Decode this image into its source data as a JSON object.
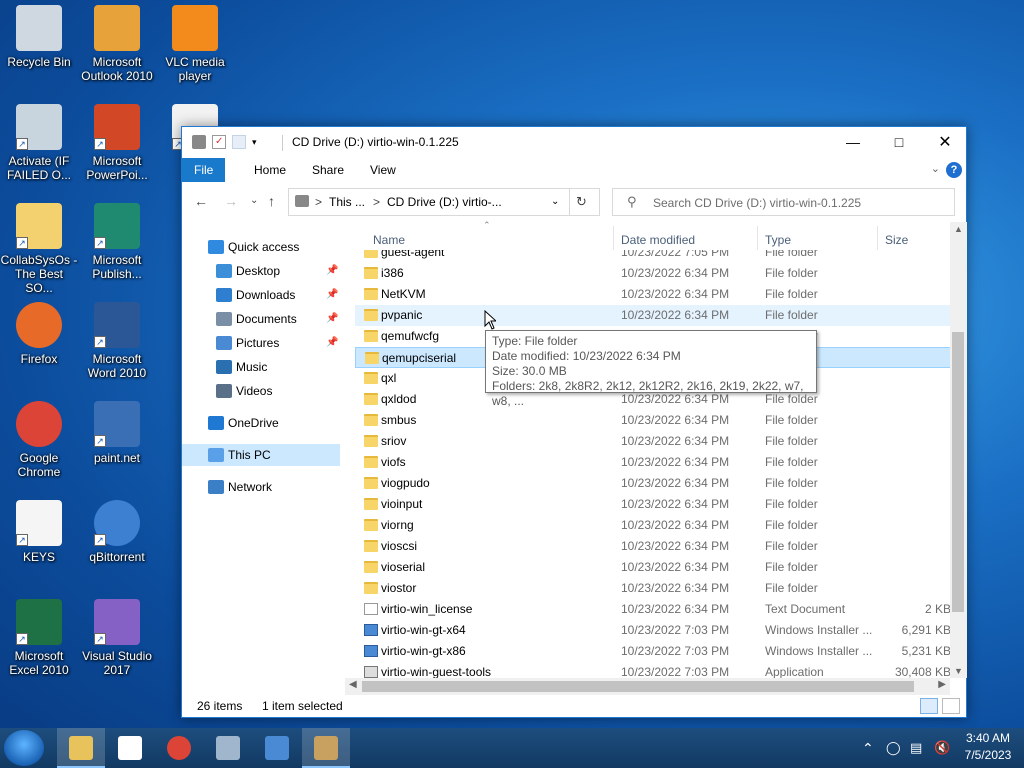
{
  "desktop": {
    "icons": [
      {
        "label": "Recycle Bin",
        "icon": "recycle-bin-icon"
      },
      {
        "label": "Microsoft Outlook 2010",
        "icon": "outlook-icon"
      },
      {
        "label": "VLC media player",
        "icon": "vlc-icon"
      },
      {
        "label": "Activate (IF FAILED O...",
        "icon": "activate-icon"
      },
      {
        "label": "Microsoft PowerPoi...",
        "icon": "powerpoint-icon"
      },
      {
        "label": "M",
        "icon": "document-icon"
      },
      {
        "label": "CollabSysOs - The Best SO...",
        "icon": "folder-icon"
      },
      {
        "label": "Microsoft Publish...",
        "icon": "publisher-icon"
      },
      {
        "label": "Firefox",
        "icon": "firefox-icon"
      },
      {
        "label": "Microsoft Word 2010",
        "icon": "word-icon"
      },
      {
        "label": "Google Chrome",
        "icon": "chrome-icon"
      },
      {
        "label": "paint.net",
        "icon": "paintnet-icon"
      },
      {
        "label": "KEYS",
        "icon": "text-file-icon"
      },
      {
        "label": "qBittorrent",
        "icon": "qbittorrent-icon"
      },
      {
        "label": "Microsoft Excel 2010",
        "icon": "excel-icon"
      },
      {
        "label": "Visual Studio 2017",
        "icon": "visual-studio-icon"
      }
    ]
  },
  "window": {
    "title": "CD Drive (D:) virtio-win-0.1.225",
    "ribbon_tabs": [
      "File",
      "Home",
      "Share",
      "View"
    ],
    "help": "?",
    "address": {
      "crumb1": "This ...",
      "crumb2": "CD Drive (D:) virtio-...",
      "sep": ">"
    },
    "search_placeholder": "Search CD Drive (D:) virtio-win-0.1.225",
    "nav": [
      {
        "label": "Quick access",
        "pinned": false
      },
      {
        "label": "Desktop",
        "pinned": true
      },
      {
        "label": "Downloads",
        "pinned": true
      },
      {
        "label": "Documents",
        "pinned": true
      },
      {
        "label": "Pictures",
        "pinned": true
      },
      {
        "label": "Music",
        "pinned": false
      },
      {
        "label": "Videos",
        "pinned": false
      },
      {
        "label": "OneDrive",
        "pinned": false
      },
      {
        "label": "This PC",
        "pinned": false
      },
      {
        "label": "Network",
        "pinned": false
      }
    ],
    "columns": {
      "name": "Name",
      "date": "Date modified",
      "type": "Type",
      "size": "Size"
    },
    "files": [
      {
        "name": "guest-agent",
        "date": "10/23/2022 7:05 PM",
        "type": "File folder",
        "size": "",
        "kind": "folder"
      },
      {
        "name": "i386",
        "date": "10/23/2022 6:34 PM",
        "type": "File folder",
        "size": "",
        "kind": "folder"
      },
      {
        "name": "NetKVM",
        "date": "10/23/2022 6:34 PM",
        "type": "File folder",
        "size": "",
        "kind": "folder"
      },
      {
        "name": "pvpanic",
        "date": "10/23/2022 6:34 PM",
        "type": "File folder",
        "size": "",
        "kind": "folder"
      },
      {
        "name": "qemufwcfg",
        "date": "10/23/2022 6:34 PM",
        "type": "File folder",
        "size": "",
        "kind": "folder"
      },
      {
        "name": "qemupciserial",
        "date": "",
        "type": "",
        "size": "",
        "kind": "folder"
      },
      {
        "name": "qxl",
        "date": "",
        "type": "",
        "size": "",
        "kind": "folder"
      },
      {
        "name": "qxldod",
        "date": "10/23/2022 6:34 PM",
        "type": "File folder",
        "size": "",
        "kind": "folder"
      },
      {
        "name": "smbus",
        "date": "10/23/2022 6:34 PM",
        "type": "File folder",
        "size": "",
        "kind": "folder"
      },
      {
        "name": "sriov",
        "date": "10/23/2022 6:34 PM",
        "type": "File folder",
        "size": "",
        "kind": "folder"
      },
      {
        "name": "viofs",
        "date": "10/23/2022 6:34 PM",
        "type": "File folder",
        "size": "",
        "kind": "folder"
      },
      {
        "name": "viogpudo",
        "date": "10/23/2022 6:34 PM",
        "type": "File folder",
        "size": "",
        "kind": "folder"
      },
      {
        "name": "vioinput",
        "date": "10/23/2022 6:34 PM",
        "type": "File folder",
        "size": "",
        "kind": "folder"
      },
      {
        "name": "viorng",
        "date": "10/23/2022 6:34 PM",
        "type": "File folder",
        "size": "",
        "kind": "folder"
      },
      {
        "name": "vioscsi",
        "date": "10/23/2022 6:34 PM",
        "type": "File folder",
        "size": "",
        "kind": "folder"
      },
      {
        "name": "vioserial",
        "date": "10/23/2022 6:34 PM",
        "type": "File folder",
        "size": "",
        "kind": "folder"
      },
      {
        "name": "viostor",
        "date": "10/23/2022 6:34 PM",
        "type": "File folder",
        "size": "",
        "kind": "folder"
      },
      {
        "name": "virtio-win_license",
        "date": "10/23/2022 6:34 PM",
        "type": "Text Document",
        "size": "2 KB",
        "kind": "doc"
      },
      {
        "name": "virtio-win-gt-x64",
        "date": "10/23/2022 7:03 PM",
        "type": "Windows Installer ...",
        "size": "6,291 KB",
        "kind": "msi"
      },
      {
        "name": "virtio-win-gt-x86",
        "date": "10/23/2022 7:03 PM",
        "type": "Windows Installer ...",
        "size": "5,231 KB",
        "kind": "msi"
      },
      {
        "name": "virtio-win-guest-tools",
        "date": "10/23/2022 7:03 PM",
        "type": "Application",
        "size": "30,408 KB",
        "kind": "app"
      }
    ],
    "tooltip": {
      "line1": "Type: File folder",
      "line2": "Date modified: 10/23/2022 6:34 PM",
      "line3": "Size: 30.0 MB",
      "line4": "Folders: 2k8, 2k8R2, 2k12, 2k12R2, 2k16, 2k19, 2k22, w7, w8, ..."
    },
    "status": {
      "items": "26 items",
      "selected": "1 item selected"
    }
  },
  "taskbar": {
    "clock_time": "3:40 AM",
    "clock_date": "7/5/2023",
    "apps": [
      "file-explorer-icon",
      "mail-icon",
      "chrome-icon",
      "image-viewer-icon",
      "control-panel-icon",
      "installer-icon"
    ]
  }
}
